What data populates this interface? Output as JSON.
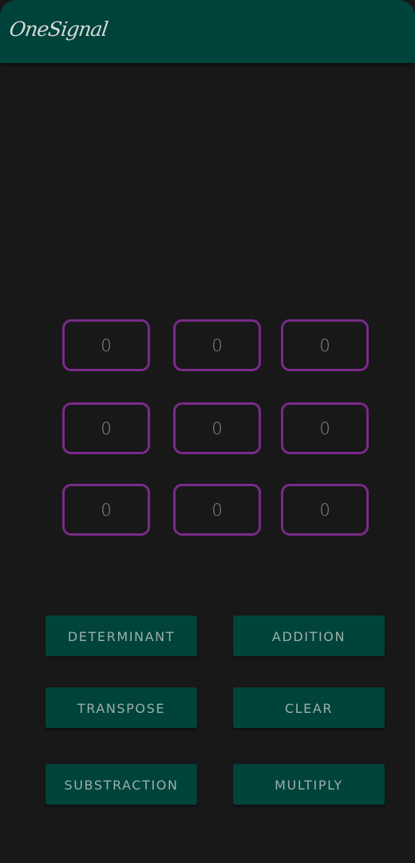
{
  "app_bar": {
    "title": "OneSignal"
  },
  "matrix": {
    "cells": [
      {
        "value": "0"
      },
      {
        "value": "0"
      },
      {
        "value": "0"
      },
      {
        "value": "0"
      },
      {
        "value": "0"
      },
      {
        "value": "0"
      },
      {
        "value": "0"
      },
      {
        "value": "0"
      },
      {
        "value": "0"
      }
    ]
  },
  "actions": {
    "determinant": "DETERMINANT",
    "addition": "ADDITION",
    "transpose": "TRANSPOSE",
    "clear": "CLEAR",
    "substraction": "SUBSTRACTION",
    "multiply": "MULTIPLY"
  },
  "colors": {
    "background": "#181818",
    "app_bar": "#00433a",
    "cell_border": "#7a2a8a",
    "button_bg": "#00433a",
    "button_text": "#9ab0ab"
  }
}
